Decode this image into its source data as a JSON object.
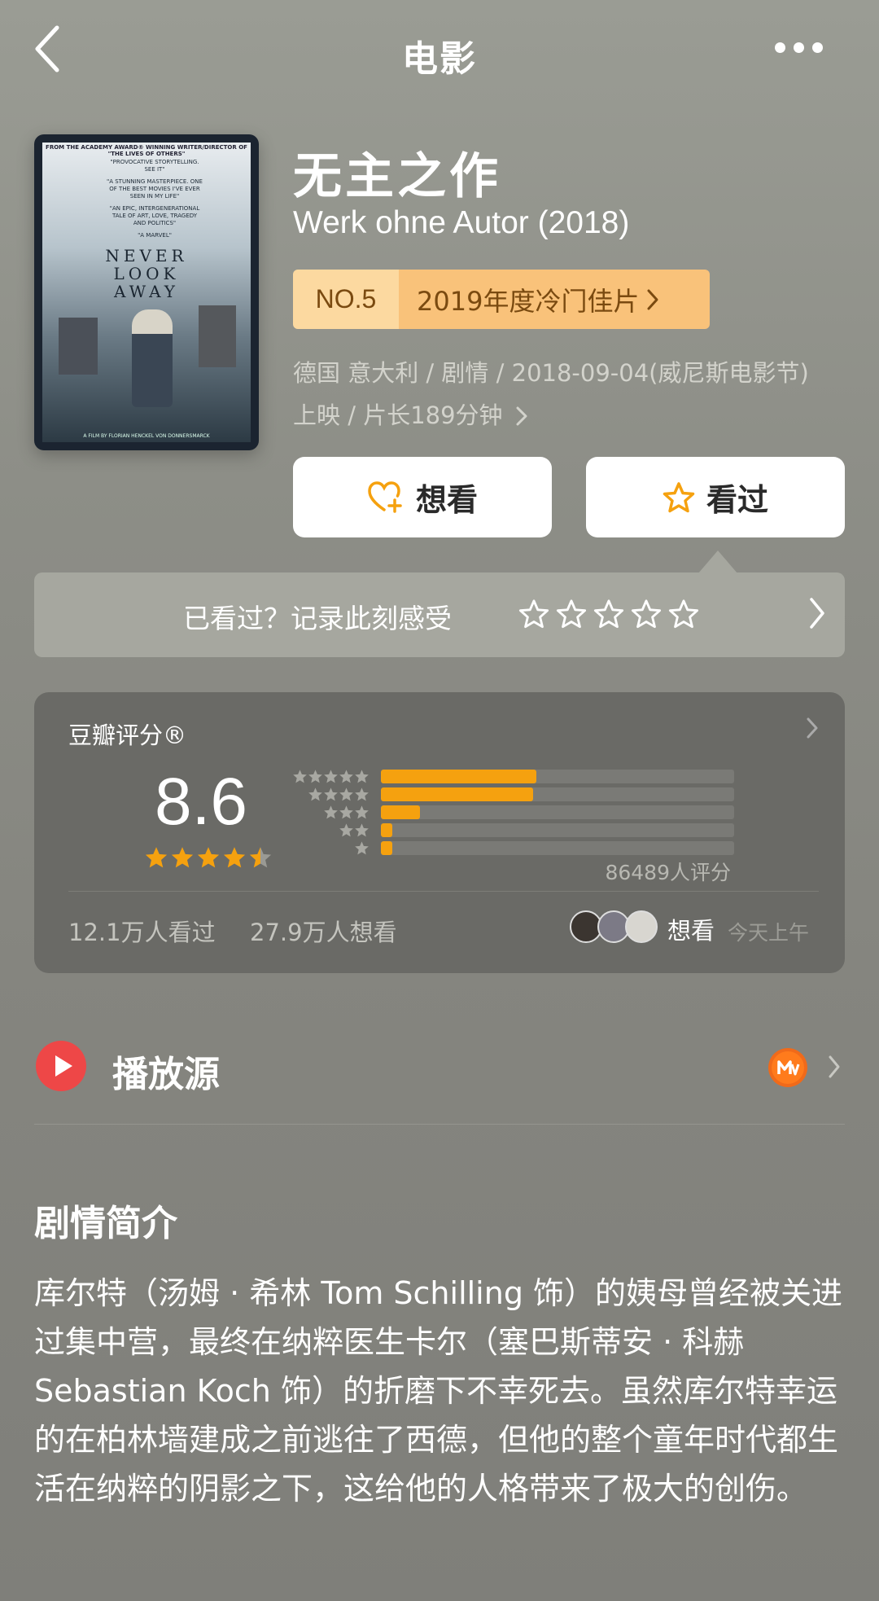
{
  "header": {
    "title": "电影"
  },
  "poster": {
    "top_text": "FROM THE ACADEMY AWARD® WINNING WRITER/DIRECTOR OF \"THE LIVES OF OTHERS\"",
    "quotes": [
      "\"PROVOCATIVE STORYTELLING. SEE IT\"",
      "\"A STUNNING MASTERPIECE. ONE OF THE BEST MOVIES I'VE EVER SEEN IN MY LIFE\"",
      "\"AN EPIC, INTERGENERATIONAL TALE OF ART, LOVE, TRAGEDY AND POLITICS\"",
      "\"A MARVEL\""
    ],
    "title_lines": [
      "NEVER",
      "LOOK",
      "AWAY"
    ],
    "bottom_text": "A FILM BY FLORIAN HENCKEL VON DONNERSMARCK"
  },
  "movie": {
    "title_cn": "无主之作",
    "title_en": "Werk ohne Autor (2018)",
    "rank_no": "NO.5",
    "rank_text": "2019年度冷门佳片",
    "meta_line1": "德国 意大利 / 剧情 / 2018-09-04(威尼斯电影节)",
    "meta_line2": "上映 / 片长189分钟"
  },
  "actions": {
    "want_label": "想看",
    "seen_label": "看过"
  },
  "record": {
    "text": "已看过？记录此刻感受"
  },
  "rating": {
    "label": "豆瓣评分®",
    "score": "8.6",
    "stars_value": 4.5,
    "distribution": [
      {
        "stars": 5,
        "fraction": 0.44
      },
      {
        "stars": 4,
        "fraction": 0.43
      },
      {
        "stars": 3,
        "fraction": 0.11
      },
      {
        "stars": 2,
        "fraction": 0.02
      },
      {
        "stars": 1,
        "fraction": 0.02
      }
    ],
    "count": "86489人评分",
    "watched": "12.1万人看过",
    "wants": "27.9万人想看",
    "friends_action": "想看",
    "friends_time": "今天上午",
    "accent_color": "#f5a10f"
  },
  "play_source": {
    "label": "播放源",
    "icon": "play-icon",
    "provider_icon": "mango-tv-icon"
  },
  "synopsis": {
    "title": "剧情简介",
    "body": "库尔特（汤姆 · 希林 Tom Schilling 饰）的姨母曾经被关进过集中营，最终在纳粹医生卡尔（塞巴斯蒂安 · 科赫 Sebastian Koch 饰）的折磨下不幸死去。虽然库尔特幸运的在柏林墙建成之前逃往了西德，但他的整个童年时代都生活在纳粹的阴影之下，这给他的人格带来了极大的创伤。"
  }
}
